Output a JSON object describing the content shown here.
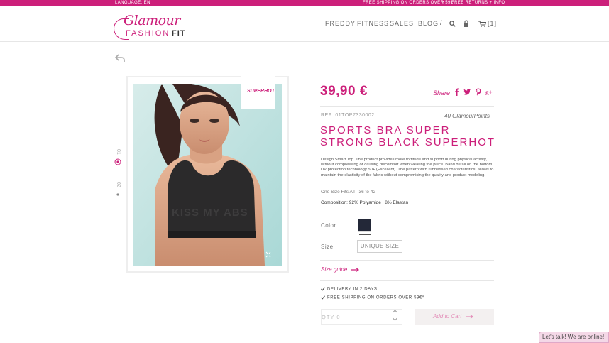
{
  "topbar": {
    "language": "LANGUAGE: EN",
    "shipping": "FREE SHIPPING ON ORDERS OVER 59€",
    "bullet": "•",
    "returns": "FREE RETURNS + INFO"
  },
  "brand": {
    "script": "Glamour",
    "fashion": "FASHION",
    "fit": "FIT"
  },
  "nav": {
    "items": [
      "FREDDY",
      "FITNESS",
      "SALES",
      "BLOG"
    ],
    "separator": "/",
    "cart_count": "[1]"
  },
  "product": {
    "badge": "SUPERHOT",
    "price": "39,90 €",
    "share_label": "Share",
    "ref": "REF: 01TOP7330002",
    "points": "40 GlamourPoints",
    "title": "SPORTS BRA SUPER STRONG BLACK SUPERHOT",
    "description": "Design Smart Top. The product provides more fortitude and support during physical activity, without compressing or causing discomfort when wearing the piece. Band detail on the bottom. UV protection technology 50+ (Excellent). The pattern with rubberised characteristics, allows to maintain the elasticity of the fabric without compromising the quality and product modeling.",
    "one_size": "One Size Fits All - 36 to 42",
    "composition": "Composition: 92% Polyamide | 8% Elastan",
    "color_label": "Color",
    "size_label": "Size",
    "size_value": "UNIQUE SIZE",
    "size_guide": "Size guide",
    "delivery": "DELIVERY IN 2 DAYS",
    "free_shipping": "FREE SHIPPING ON ORDERS OVER 59€*",
    "qty_label": "QTY 0",
    "add_to_cart": "Add to Cart",
    "thumbs": [
      "01",
      "02"
    ],
    "print_text": "KISS MY ABS"
  },
  "chat": {
    "label": "Let's talk! We are online!"
  },
  "colors": {
    "accent": "#cc1f7a",
    "swatch": "#232838"
  }
}
